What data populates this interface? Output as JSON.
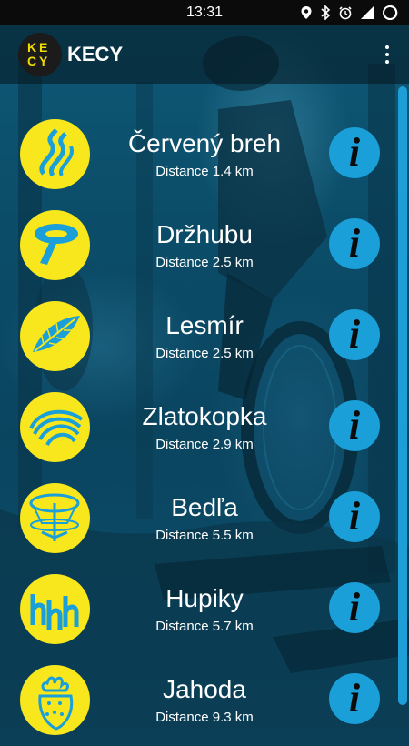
{
  "status_bar": {
    "time": "13:31"
  },
  "app": {
    "logo_letters": [
      "K",
      "E",
      "C",
      "Y"
    ],
    "title": "KECY"
  },
  "trails": [
    {
      "name": "Červený breh",
      "distance": "Distance 1.4 km",
      "icon": "flame-waves-icon"
    },
    {
      "name": "Držhubu",
      "distance": "Distance 2.5 km",
      "icon": "mushroom-icon"
    },
    {
      "name": "Lesmír",
      "distance": "Distance 2.5 km",
      "icon": "fern-leaf-icon"
    },
    {
      "name": "Zlatokopka",
      "distance": "Distance 2.9 km",
      "icon": "wave-stripes-icon"
    },
    {
      "name": "Bedľa",
      "distance": "Distance 5.5 km",
      "icon": "parasol-mushroom-icon"
    },
    {
      "name": "Hupiky",
      "distance": "Distance 5.7 km",
      "icon": "hhh-letters-icon"
    },
    {
      "name": "Jahoda",
      "distance": "Distance 9.3 km",
      "icon": "strawberry-icon"
    }
  ],
  "colors": {
    "icon_yellow": "#f7e71c",
    "icon_blue": "#1a9fd8",
    "info_blue": "#1a9fd8",
    "background": "#0b4d69"
  }
}
